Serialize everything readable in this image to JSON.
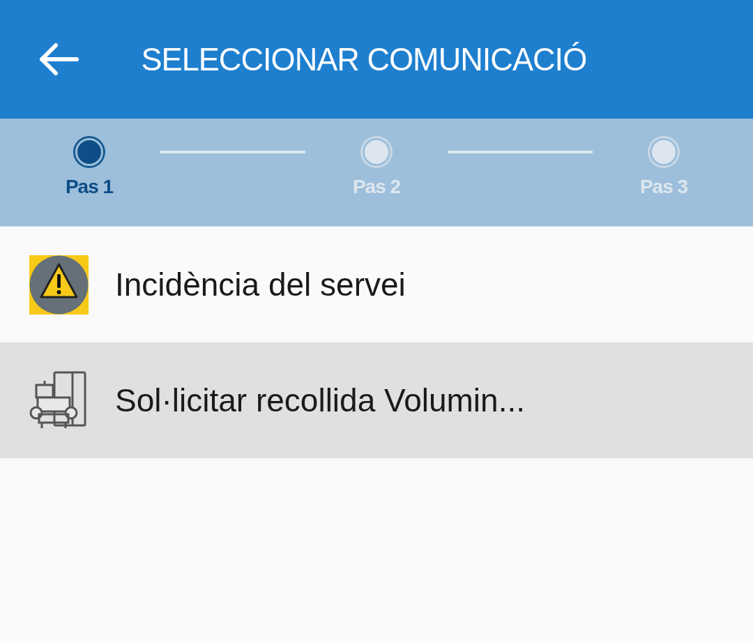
{
  "header": {
    "title": "SELECCIONAR COMUNICACIÓ"
  },
  "steps": [
    {
      "label": "Pas 1",
      "selected": true
    },
    {
      "label": "Pas 2",
      "selected": false
    },
    {
      "label": "Pas 3",
      "selected": false
    }
  ],
  "items": [
    {
      "kind": "warning",
      "label": "Incidència del servei",
      "selected": false
    },
    {
      "kind": "furniture",
      "label": "Sol·licitar recollida Volumin...",
      "selected": true
    }
  ]
}
